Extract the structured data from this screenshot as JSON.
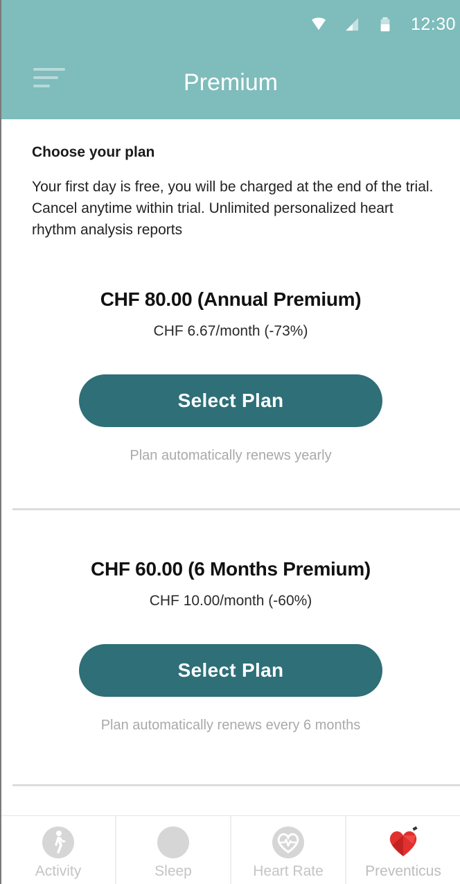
{
  "status_bar": {
    "time": "12:30",
    "icons": [
      "wifi-icon",
      "signal-icon",
      "battery-icon"
    ]
  },
  "header": {
    "title": "Premium",
    "menu_icon": "hamburger-menu-icon",
    "background_color": "#7fbcbc"
  },
  "intro": {
    "heading": "Choose your plan",
    "text": "Your first day is free, you will be charged at the end of the trial. Cancel anytime within trial. Unlimited personalized heart rhythm analysis reports"
  },
  "plans": [
    {
      "title": "CHF 80.00 (Annual Premium)",
      "monthly": "CHF 6.67/month (-73%)",
      "button_label": "Select Plan",
      "note": "Plan automatically renews yearly"
    },
    {
      "title": "CHF 60.00 (6 Months Premium)",
      "monthly": "CHF 10.00/month (-60%)",
      "button_label": "Select Plan",
      "note": "Plan automatically renews every 6 months"
    }
  ],
  "button_color": "#2e6f78",
  "tabbar": {
    "tabs": [
      {
        "label": "Activity",
        "icon": "walking-person-icon"
      },
      {
        "label": "Sleep",
        "icon": "moon-icon"
      },
      {
        "label": "Heart Rate",
        "icon": "heart-rate-icon"
      },
      {
        "label": "Preventicus",
        "icon": "preventicus-heart-icon",
        "active": true
      }
    ],
    "active_color": "#e0312f"
  }
}
